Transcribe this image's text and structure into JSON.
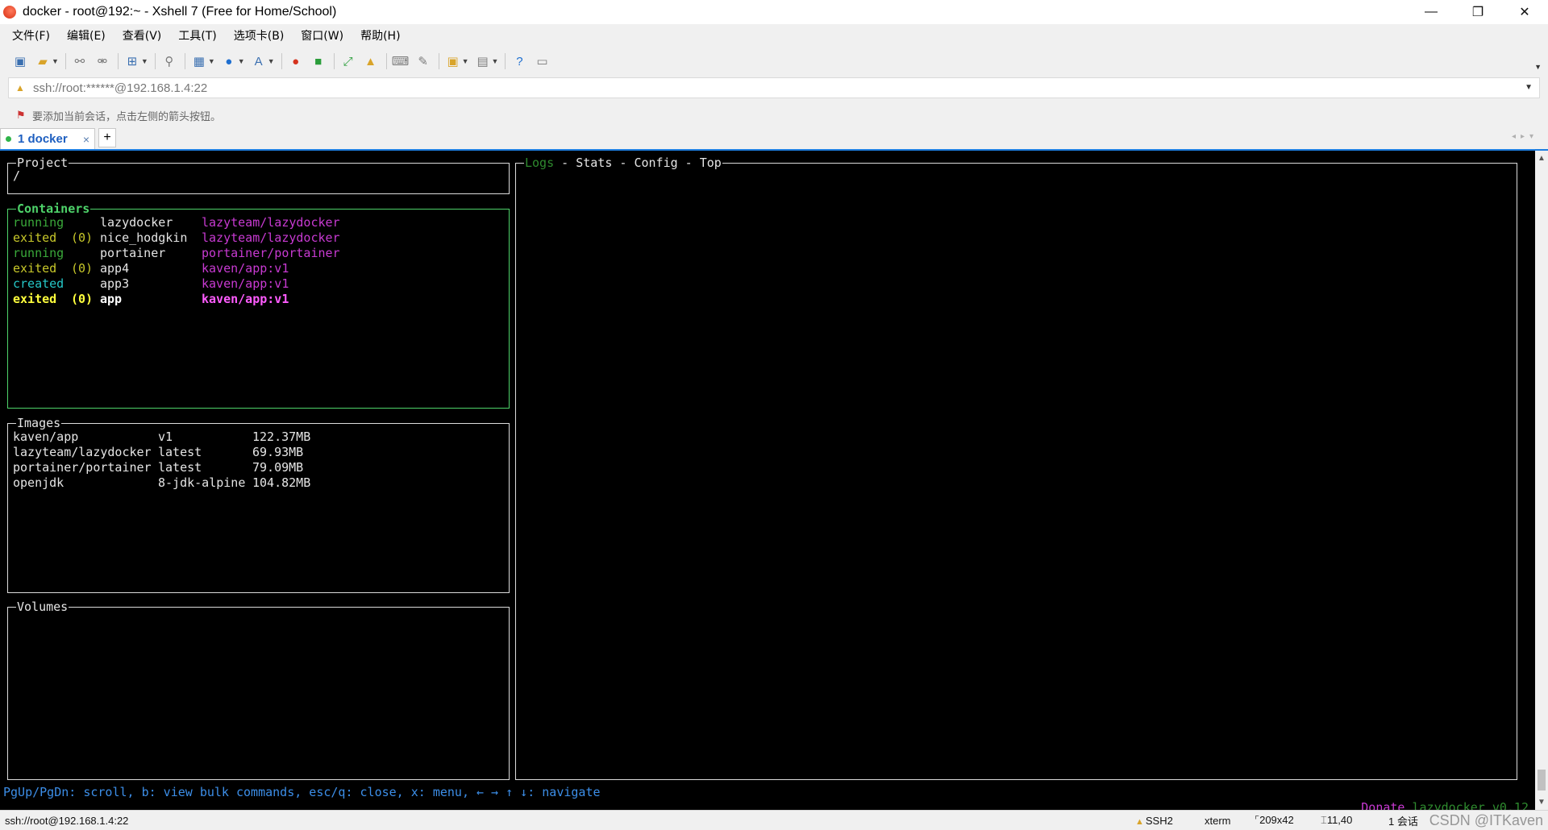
{
  "window": {
    "title": "docker - root@192:~ - Xshell 7 (Free for Home/School)",
    "minimize": "—",
    "restore": "❐",
    "close": "✕"
  },
  "menu": [
    "文件(F)",
    "编辑(E)",
    "查看(V)",
    "工具(T)",
    "选项卡(B)",
    "窗口(W)",
    "帮助(H)"
  ],
  "address": {
    "value": "ssh://root:******@192.168.1.4:22"
  },
  "hint": {
    "text": "要添加当前会话，点击左侧的箭头按钮。"
  },
  "tab": {
    "label": "1 docker",
    "close": "×",
    "add": "+"
  },
  "terminal": {
    "project": {
      "title": "Project",
      "value": "/"
    },
    "containers": {
      "title": "Containers",
      "rows": [
        {
          "status": "running",
          "code": "",
          "name": "lazydocker",
          "image": "lazyteam/lazydocker"
        },
        {
          "status": "exited",
          "code": "(0)",
          "name": "nice_hodgkin",
          "image": "lazyteam/lazydocker"
        },
        {
          "status": "running",
          "code": "",
          "name": "portainer",
          "image": "portainer/portainer"
        },
        {
          "status": "exited",
          "code": "(0)",
          "name": "app4",
          "image": "kaven/app:v1"
        },
        {
          "status": "created",
          "code": "",
          "name": "app3",
          "image": "kaven/app:v1"
        },
        {
          "status": "exited",
          "code": "(0)",
          "name": "app",
          "image": "kaven/app:v1"
        }
      ]
    },
    "images": {
      "title": "Images",
      "rows": [
        {
          "name": "kaven/app",
          "tag": "v1",
          "size": "122.37MB"
        },
        {
          "name": "lazyteam/lazydocker",
          "tag": "latest",
          "size": "69.93MB"
        },
        {
          "name": "portainer/portainer",
          "tag": "latest",
          "size": "79.09MB"
        },
        {
          "name": "openjdk",
          "tag": "8-jdk-alpine",
          "size": "104.82MB"
        }
      ]
    },
    "volumes": {
      "title": "Volumes"
    },
    "main": {
      "tabs": [
        "Logs",
        "Stats",
        "Config",
        "Top"
      ],
      "separator": " - "
    },
    "footer": {
      "keys": "PgUp/PgDn: scroll, b: view bulk commands, esc/q: close, x: menu, ← → ↑ ↓: navigate",
      "donate": "Donate",
      "version": "lazydocker v0.12"
    }
  },
  "status": {
    "connection": "ssh://root@192.168.1.4:22",
    "protocol": "SSH2",
    "term": "xterm",
    "size": "209x42",
    "cursor": "11,40",
    "sessions": "1 会话",
    "watermark": "CSDN @ITKaven"
  },
  "colors": {
    "accent_tab": "#1e7ee0",
    "active_panel": "#4ed36a",
    "running": "#3aa93a",
    "exited": "#c8c82a",
    "created": "#25c7c7",
    "image": "#c83ad2",
    "footer_keys": "#3c8ee8"
  }
}
